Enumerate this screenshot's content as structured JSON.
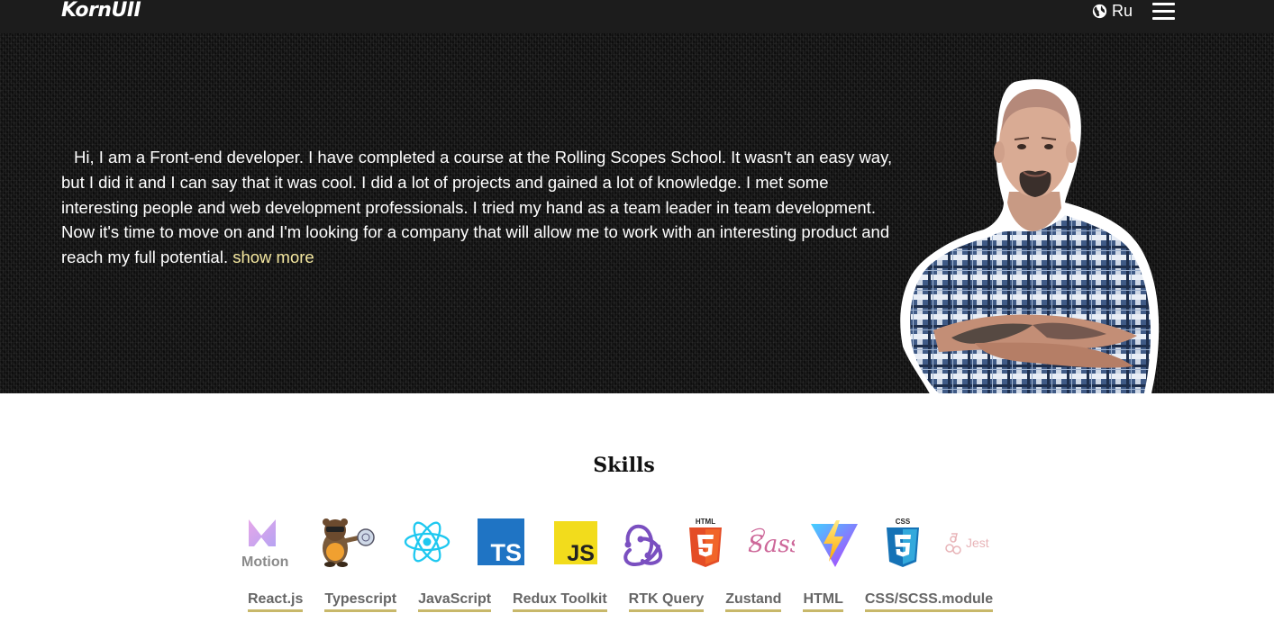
{
  "header": {
    "logo": "KornUII",
    "language_label": "Ru"
  },
  "hero": {
    "intro": "Hi, I am a Front-end developer. I have completed a course at the Rolling Scopes School. It wasn't an easy way, but I did it and I can say that it was cool. I did a lot of projects and gained a lot of knowledge. I met some interesting people and web development professionals. I tried my hand as a team leader in team development. Now it's time to move on and I'm looking for a company that will allow me to work with an interesting product and reach my full potential.",
    "show_more": "show more"
  },
  "skills": {
    "title": "Skills",
    "icons": [
      "framer-motion-icon",
      "rolling-scopes-icon",
      "react-icon",
      "typescript-icon",
      "javascript-icon",
      "redux-icon",
      "html5-icon",
      "sass-icon",
      "vite-icon",
      "css3-icon",
      "jest-icon"
    ],
    "icon_texts": {
      "motion": "Motion",
      "ts": "TS",
      "js": "JS",
      "html": "HTML",
      "sass": "Sass",
      "css": "CSS",
      "jest": "Jest"
    },
    "tabs": [
      "React.js",
      "Typescript",
      "JavaScript",
      "Redux Toolkit",
      "RTK Query",
      "Zustand",
      "HTML",
      "CSS/SCSS.module"
    ]
  },
  "colors": {
    "header_bg": "#1c1c1c",
    "accent_link": "#f5e8a0",
    "tab_underline": "#c8b86a"
  }
}
